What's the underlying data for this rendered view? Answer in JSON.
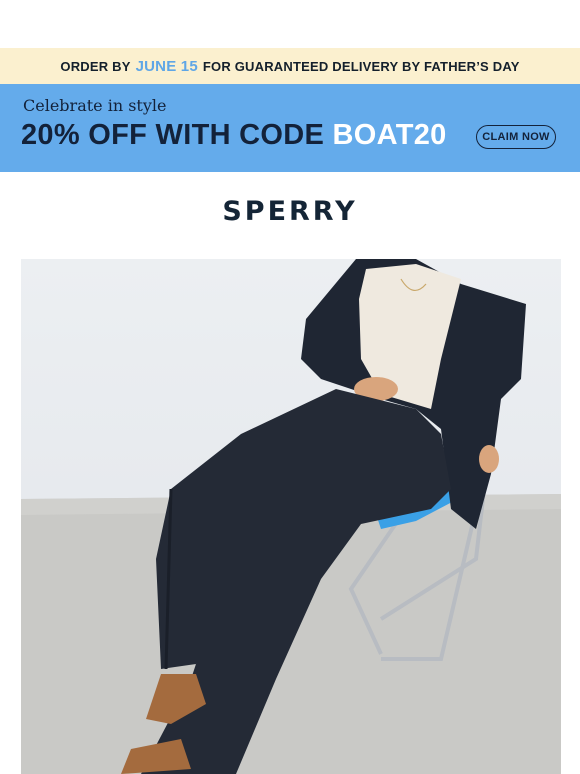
{
  "shipping_banner": {
    "prefix": "ORDER BY",
    "date": "JUNE 15",
    "suffix": "FOR GUARANTEED DELIVERY BY FATHER’S DAY"
  },
  "promo": {
    "kicker": "Celebrate in style",
    "headline": "20% OFF WITH CODE",
    "code": "BOAT20",
    "cta_label": "CLAIM NOW"
  },
  "brand": {
    "logo_text": "SPERRY"
  },
  "colors": {
    "shipping_bg": "#fbf0cf",
    "promo_bg": "#64abeb",
    "accent_blue": "#5fa6e6",
    "navy": "#13223a"
  },
  "hero": {
    "image_subject": "model-in-navy-suit-seated-on-blue-chair"
  }
}
